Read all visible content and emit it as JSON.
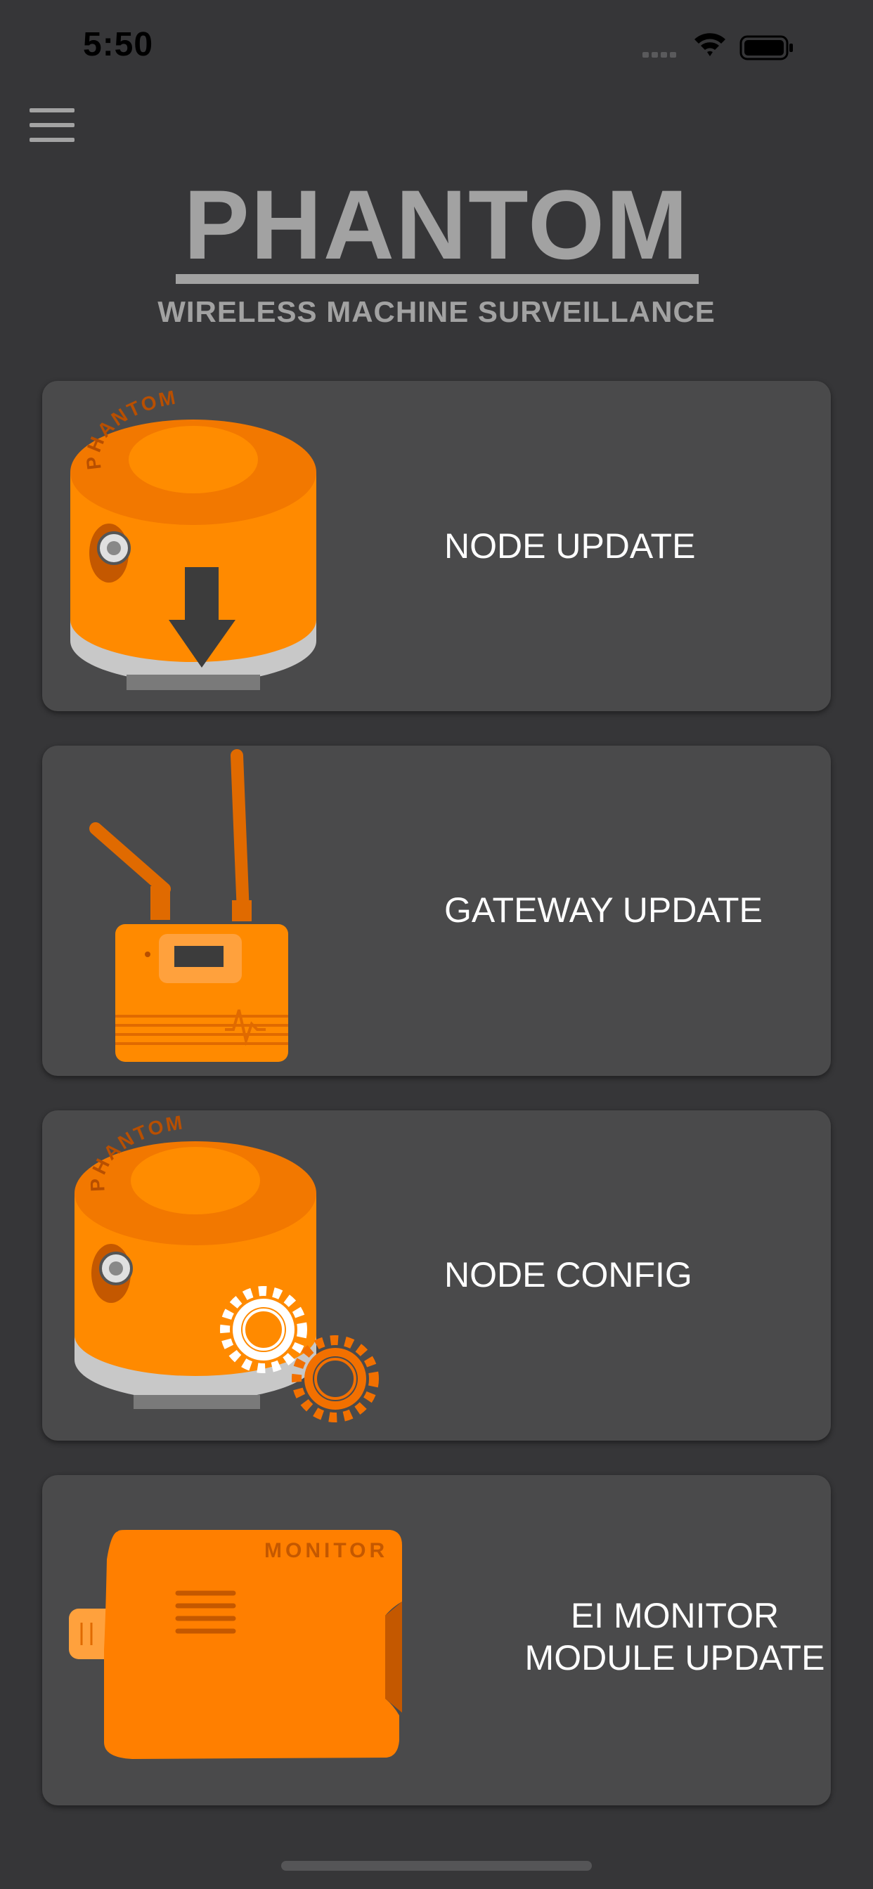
{
  "status_bar": {
    "time": "5:50",
    "icons": [
      "cellular-signal-icon",
      "wifi-icon",
      "battery-icon"
    ]
  },
  "header": {
    "menu_icon": "hamburger-menu-icon",
    "title": "PHANTOM",
    "subtitle": "WIRELESS MACHINE SURVEILLANCE"
  },
  "cards": [
    {
      "label": "NODE UPDATE",
      "icon": "node-download-icon",
      "icon_text": "PHANTOM"
    },
    {
      "label": "GATEWAY UPDATE",
      "icon": "gateway-icon"
    },
    {
      "label": "NODE CONFIG",
      "icon": "node-config-icon",
      "icon_text": "PHANTOM"
    },
    {
      "label_line1": "EI MONITOR",
      "label_line2": "MODULE UPDATE",
      "icon": "monitor-module-icon",
      "icon_text": "MONITOR"
    }
  ],
  "colors": {
    "background": "#363638",
    "card": "#4a4a4b",
    "brand_text": "#a2a2a2",
    "accent_orange": "#ff8a00",
    "accent_orange_dark": "#e06a00"
  }
}
